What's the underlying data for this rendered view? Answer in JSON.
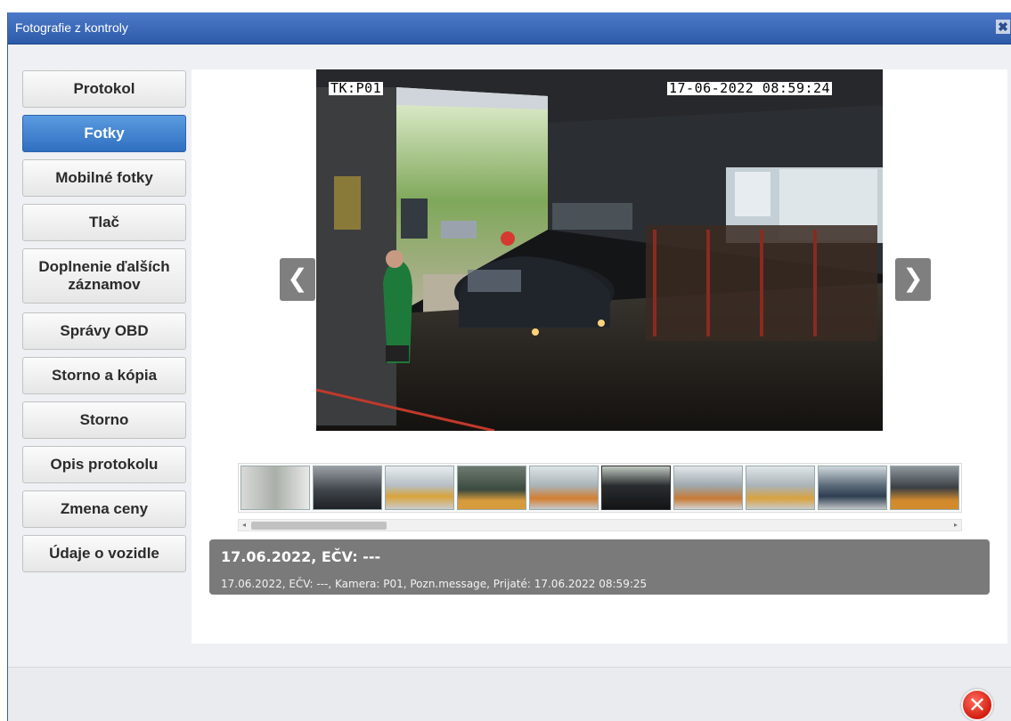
{
  "window": {
    "title": "Fotografie z kontroly",
    "close_glyph": "✖"
  },
  "sidebar": {
    "items": [
      {
        "label": "Protokol",
        "active": false
      },
      {
        "label": "Fotky",
        "active": true
      },
      {
        "label": "Mobilné fotky",
        "active": false
      },
      {
        "label": "Tlač",
        "active": false
      },
      {
        "label": "Doplnenie ďalších záznamov",
        "active": false
      },
      {
        "label": "Správy OBD",
        "active": false
      },
      {
        "label": "Storno a kópia",
        "active": false
      },
      {
        "label": "Storno",
        "active": false
      },
      {
        "label": "Opis protokolu",
        "active": false
      },
      {
        "label": "Zmena ceny",
        "active": false
      },
      {
        "label": "Údaje o vozidle",
        "active": false
      }
    ]
  },
  "viewer": {
    "camera_label": "TK:P01",
    "timestamp": "17-06-2022 08:59:24",
    "prev_icon": "chevron-left-icon",
    "next_icon": "chevron-right-icon",
    "prev_glyph": "❮",
    "next_glyph": "❯"
  },
  "thumbnails": {
    "count_visible": 10,
    "selected_index": 5
  },
  "info": {
    "title": "17.06.2022, EČV: ---",
    "detail": "17.06.2022, EČV: ---, Kamera: P01, Pozn.message, Prijaté: 17.06.2022 08:59:25"
  },
  "footer": {
    "close_icon": "close-circle-icon",
    "close_glyph": "✕"
  },
  "colors": {
    "titlebar": "#3b66b5",
    "active_button": "#3f7fcf",
    "info_panel": "#7a7a7a",
    "close_button": "#e0281a"
  }
}
